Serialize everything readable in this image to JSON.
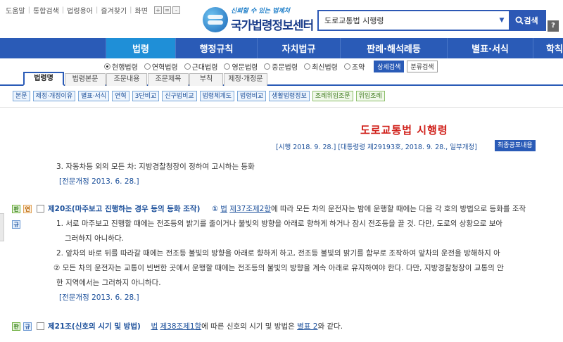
{
  "util": {
    "links": [
      "도움말",
      "통합검색",
      "법령용어",
      "즐겨찾기",
      "화면"
    ],
    "zoom": [
      "+",
      "=",
      "-"
    ]
  },
  "logo": {
    "tagline": "신뢰할 수 있는 법제처",
    "name": "국가법령정보센터"
  },
  "search": {
    "value": "도로교통법 시행령",
    "button": "검색",
    "help": "?"
  },
  "nav": [
    "법령",
    "행정규칙",
    "자치법규",
    "판례·해석례등",
    "별표·서식",
    "학칙"
  ],
  "radios": [
    {
      "label": "현행법령",
      "checked": true
    },
    {
      "label": "연혁법령",
      "checked": false
    },
    {
      "label": "근대법령",
      "checked": false
    },
    {
      "label": "영문법령",
      "checked": false
    },
    {
      "label": "중문법령",
      "checked": false
    },
    {
      "label": "최신법령",
      "checked": false
    },
    {
      "label": "조약",
      "checked": false
    }
  ],
  "search_buttons": {
    "detail": "상세검색",
    "category": "분류검색"
  },
  "tabs": [
    "법령명",
    "법령본문",
    "조문내용",
    "조문제목",
    "부칙",
    "제정·개정문"
  ],
  "subs": [
    "본문",
    "제정·개정이유",
    "별표·서식",
    "연혁",
    "3단비교",
    "신구법비교",
    "법령체계도",
    "법령비교",
    "생활법령정보",
    "조례위임조문",
    "위임조례"
  ],
  "law": {
    "title": "도로교통법 시행령",
    "promulgation": "[시행 2018. 9. 28.] [대통령령 제29193호, 2018. 9. 28., 일부개정]",
    "latest_button": "최종공포내용"
  },
  "content": {
    "item3": "3. 자동차등 외의 모든 차: 지방경찰청장이 정하여 고시하는 등화",
    "amend1": "[전문개정 2013. 6. 28.]",
    "art20": {
      "badges": [
        "판",
        "연",
        "규"
      ],
      "title": "제20조(마주보고 진행하는 경우 등의 등화 조작)",
      "para_mark": "①",
      "law_word": "법",
      "ref": "제37조제2항",
      "text": "에 따라 모든 차의 운전자는 밤에 운행할 때에는 다음 각 호의 방법으로 등화를 조작",
      "item1a": "1. 서로 마주보고 진행할 때에는 전조등의 밝기를 줄이거나 불빛의 방향을 아래로 향하게 하거나 잠시 전조등을 끌 것. 다만, 도로의 상황으로 보아",
      "item1b": "그러하지 아니하다.",
      "item2": "2. 앞차의 바로 뒤를 따라갈 때에는 전조등 불빛의 방향을 아래로 향하게 하고, 전조등 불빛의 밝기를 함부로 조작하여 앞차의 운전을 방해하지 아",
      "para2a": "② 모든 차의 운전자는 교통이 빈번한 곳에서 운행할 때에는 전조등의 불빛의 방향을 계속 아래로 유지하여야 한다. 다만, 지방경찰청장이 교통의 안",
      "para2b": "한 지역에서는 그러하지 아니하다.",
      "amend": "[전문개정 2013. 6. 28.]"
    },
    "art21": {
      "badges": [
        "판",
        "규"
      ],
      "title": "제21조(신호의 시기 및 방법)",
      "law_word": "법",
      "ref": "제38조제1항",
      "mid": "에 따른 신호의 시기 및 방법은",
      "table": "별표 2",
      "tail": "와 같다."
    }
  }
}
